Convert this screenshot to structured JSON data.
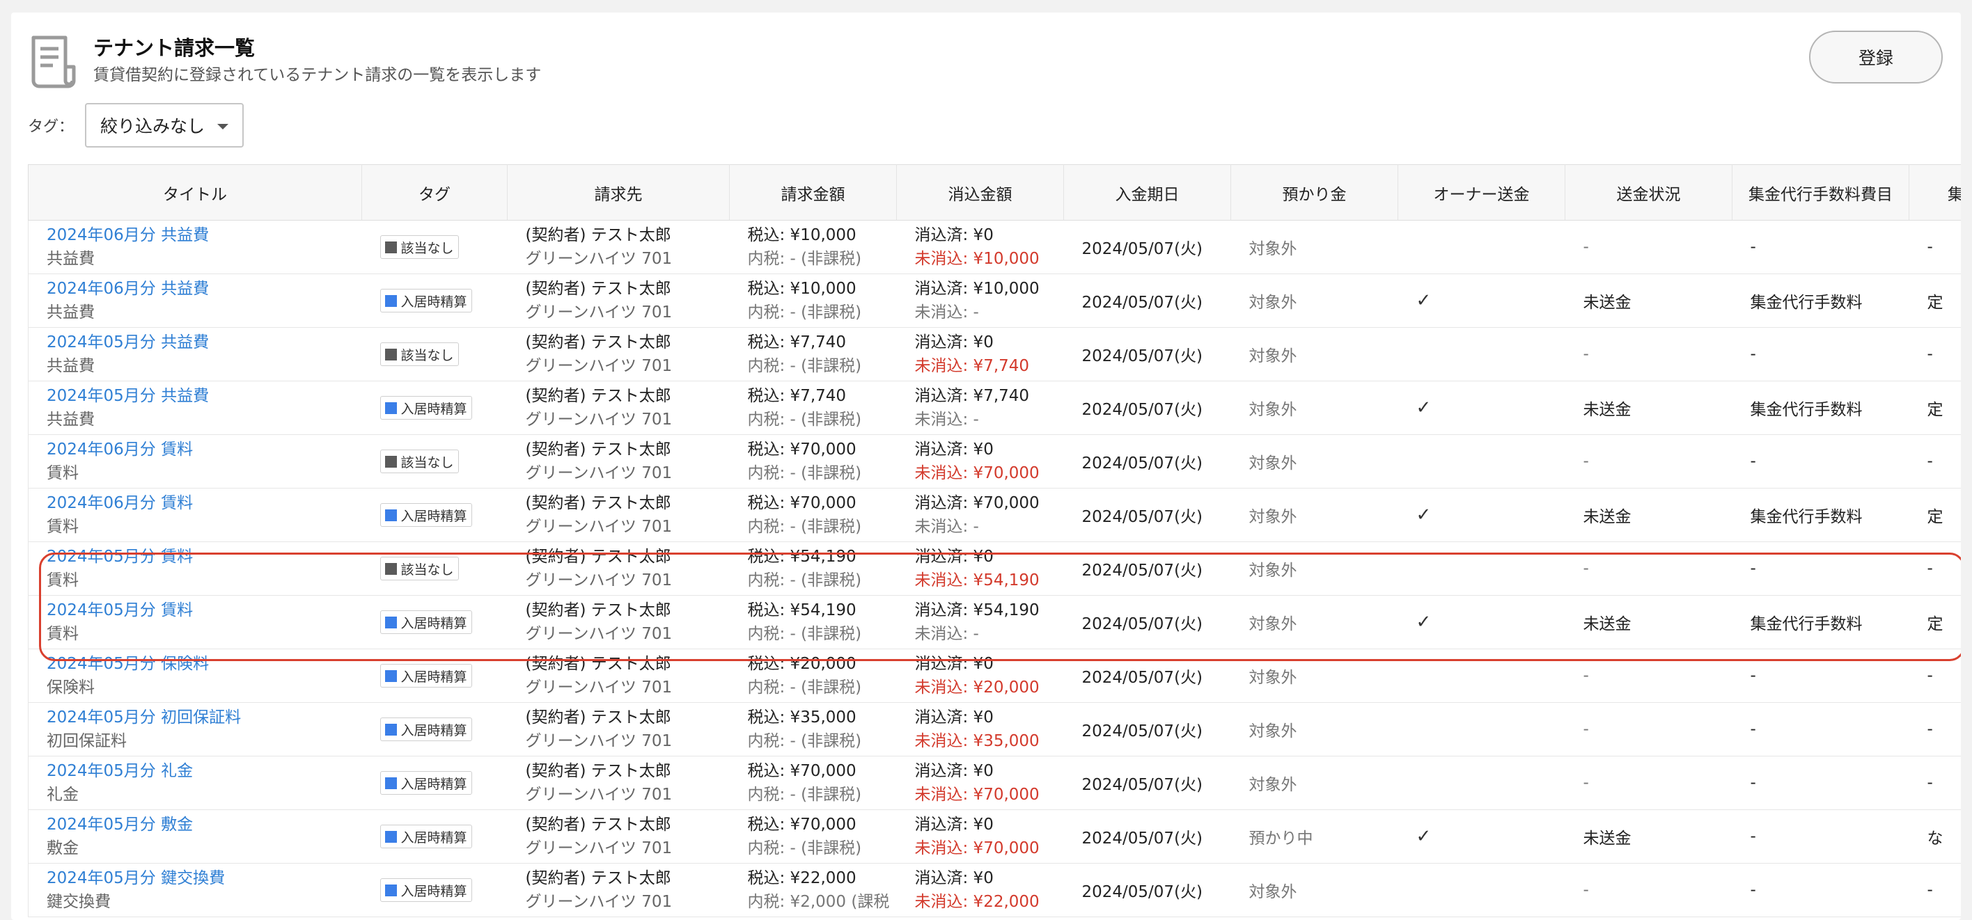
{
  "header": {
    "title": "テナント請求一覧",
    "subtitle": "賃貸借契約に登録されているテナント請求の一覧を表示します",
    "register_label": "登録"
  },
  "filter": {
    "tag_label": "タグ：",
    "tag_selected": "絞り込みなし"
  },
  "table": {
    "columns": [
      "タイトル",
      "タグ",
      "請求先",
      "請求金額",
      "消込金額",
      "入金期日",
      "預かり金",
      "オーナー送金",
      "送金状況",
      "集金代行手数料費目",
      "集"
    ],
    "rows": [
      {
        "title": "2024年06月分 共益費",
        "subtitle": "共益費",
        "tag": "該当なし",
        "tag_color": "#5a5a5a",
        "party": "(契約者) テスト太郎",
        "property": "グリーンハイツ 701",
        "amount": "税込: ¥10,000",
        "tax": "内税: - (非課税)",
        "cleared": "消込済: ¥0",
        "uncleared": "未消込: ¥10,000",
        "uncleared_red": true,
        "due": "2024/05/07(火)",
        "deposit": "対象外",
        "owner": "",
        "status": "-",
        "fee": "-",
        "last": "-"
      },
      {
        "title": "2024年06月分 共益費",
        "subtitle": "共益費",
        "tag": "入居時精算",
        "tag_color": "#3a7ee8",
        "party": "(契約者) テスト太郎",
        "property": "グリーンハイツ 701",
        "amount": "税込: ¥10,000",
        "tax": "内税: - (非課税)",
        "cleared": "消込済: ¥10,000",
        "uncleared": "未消込: -",
        "uncleared_red": false,
        "due": "2024/05/07(火)",
        "deposit": "対象外",
        "owner": "✓",
        "status": "未送金",
        "fee": "集金代行手数料",
        "last": "定"
      },
      {
        "title": "2024年05月分 共益費",
        "subtitle": "共益費",
        "tag": "該当なし",
        "tag_color": "#5a5a5a",
        "party": "(契約者) テスト太郎",
        "property": "グリーンハイツ 701",
        "amount": "税込: ¥7,740",
        "tax": "内税: - (非課税)",
        "cleared": "消込済: ¥0",
        "uncleared": "未消込: ¥7,740",
        "uncleared_red": true,
        "due": "2024/05/07(火)",
        "deposit": "対象外",
        "owner": "",
        "status": "-",
        "fee": "-",
        "last": "-"
      },
      {
        "title": "2024年05月分 共益費",
        "subtitle": "共益費",
        "tag": "入居時精算",
        "tag_color": "#3a7ee8",
        "party": "(契約者) テスト太郎",
        "property": "グリーンハイツ 701",
        "amount": "税込: ¥7,740",
        "tax": "内税: - (非課税)",
        "cleared": "消込済: ¥7,740",
        "uncleared": "未消込: -",
        "uncleared_red": false,
        "due": "2024/05/07(火)",
        "deposit": "対象外",
        "owner": "✓",
        "status": "未送金",
        "fee": "集金代行手数料",
        "last": "定"
      },
      {
        "title": "2024年06月分 賃料",
        "subtitle": "賃料",
        "tag": "該当なし",
        "tag_color": "#5a5a5a",
        "party": "(契約者) テスト太郎",
        "property": "グリーンハイツ 701",
        "amount": "税込: ¥70,000",
        "tax": "内税: - (非課税)",
        "cleared": "消込済: ¥0",
        "uncleared": "未消込: ¥70,000",
        "uncleared_red": true,
        "due": "2024/05/07(火)",
        "deposit": "対象外",
        "owner": "",
        "status": "-",
        "fee": "-",
        "last": "-"
      },
      {
        "title": "2024年06月分 賃料",
        "subtitle": "賃料",
        "tag": "入居時精算",
        "tag_color": "#3a7ee8",
        "party": "(契約者) テスト太郎",
        "property": "グリーンハイツ 701",
        "amount": "税込: ¥70,000",
        "tax": "内税: - (非課税)",
        "cleared": "消込済: ¥70,000",
        "uncleared": "未消込: -",
        "uncleared_red": false,
        "due": "2024/05/07(火)",
        "deposit": "対象外",
        "owner": "✓",
        "status": "未送金",
        "fee": "集金代行手数料",
        "last": "定"
      },
      {
        "title": "2024年05月分 賃料",
        "subtitle": "賃料",
        "tag": "該当なし",
        "tag_color": "#5a5a5a",
        "party": "(契約者) テスト太郎",
        "property": "グリーンハイツ 701",
        "amount": "税込: ¥54,190",
        "tax": "内税: - (非課税)",
        "cleared": "消込済: ¥0",
        "uncleared": "未消込: ¥54,190",
        "uncleared_red": true,
        "due": "2024/05/07(火)",
        "deposit": "対象外",
        "owner": "",
        "status": "-",
        "fee": "-",
        "last": "-"
      },
      {
        "title": "2024年05月分 賃料",
        "subtitle": "賃料",
        "tag": "入居時精算",
        "tag_color": "#3a7ee8",
        "party": "(契約者) テスト太郎",
        "property": "グリーンハイツ 701",
        "amount": "税込: ¥54,190",
        "tax": "内税: - (非課税)",
        "cleared": "消込済: ¥54,190",
        "uncleared": "未消込: -",
        "uncleared_red": false,
        "due": "2024/05/07(火)",
        "deposit": "対象外",
        "owner": "✓",
        "status": "未送金",
        "fee": "集金代行手数料",
        "last": "定"
      },
      {
        "title": "2024年05月分 保険料",
        "subtitle": "保険料",
        "tag": "入居時精算",
        "tag_color": "#3a7ee8",
        "party": "(契約者) テスト太郎",
        "property": "グリーンハイツ 701",
        "amount": "税込: ¥20,000",
        "tax": "内税: - (非課税)",
        "cleared": "消込済: ¥0",
        "uncleared": "未消込: ¥20,000",
        "uncleared_red": true,
        "due": "2024/05/07(火)",
        "deposit": "対象外",
        "owner": "",
        "status": "-",
        "fee": "-",
        "last": "-"
      },
      {
        "title": "2024年05月分 初回保証料",
        "subtitle": "初回保証料",
        "tag": "入居時精算",
        "tag_color": "#3a7ee8",
        "party": "(契約者) テスト太郎",
        "property": "グリーンハイツ 701",
        "amount": "税込: ¥35,000",
        "tax": "内税: - (非課税)",
        "cleared": "消込済: ¥0",
        "uncleared": "未消込: ¥35,000",
        "uncleared_red": true,
        "due": "2024/05/07(火)",
        "deposit": "対象外",
        "owner": "",
        "status": "-",
        "fee": "-",
        "last": "-"
      },
      {
        "title": "2024年05月分 礼金",
        "subtitle": "礼金",
        "tag": "入居時精算",
        "tag_color": "#3a7ee8",
        "party": "(契約者) テスト太郎",
        "property": "グリーンハイツ 701",
        "amount": "税込: ¥70,000",
        "tax": "内税: - (非課税)",
        "cleared": "消込済: ¥0",
        "uncleared": "未消込: ¥70,000",
        "uncleared_red": true,
        "due": "2024/05/07(火)",
        "deposit": "対象外",
        "owner": "",
        "status": "-",
        "fee": "-",
        "last": "-"
      },
      {
        "title": "2024年05月分 敷金",
        "subtitle": "敷金",
        "tag": "入居時精算",
        "tag_color": "#3a7ee8",
        "party": "(契約者) テスト太郎",
        "property": "グリーンハイツ 701",
        "amount": "税込: ¥70,000",
        "tax": "内税: - (非課税)",
        "cleared": "消込済: ¥0",
        "uncleared": "未消込: ¥70,000",
        "uncleared_red": true,
        "due": "2024/05/07(火)",
        "deposit": "預かり中",
        "owner": "✓",
        "status": "未送金",
        "fee": "-",
        "last": "な"
      },
      {
        "title": "2024年05月分 鍵交換費",
        "subtitle": "鍵交換費",
        "tag": "入居時精算",
        "tag_color": "#3a7ee8",
        "party": "(契約者) テスト太郎",
        "property": "グリーンハイツ 701",
        "amount": "税込: ¥22,000",
        "tax": "内税: ¥2,000 (課税",
        "cleared": "消込済: ¥0",
        "uncleared": "未消込: ¥22,000",
        "uncleared_red": true,
        "due": "2024/05/07(火)",
        "deposit": "対象外",
        "owner": "",
        "status": "-",
        "fee": "-",
        "last": "-"
      }
    ]
  },
  "colors": {
    "link": "#2f7fd4",
    "alert": "#d33a2c",
    "highlight_border": "#d9402f"
  },
  "icons": {
    "header": "document-icon",
    "dropdown": "caret-down-icon",
    "check": "checkmark-icon"
  }
}
